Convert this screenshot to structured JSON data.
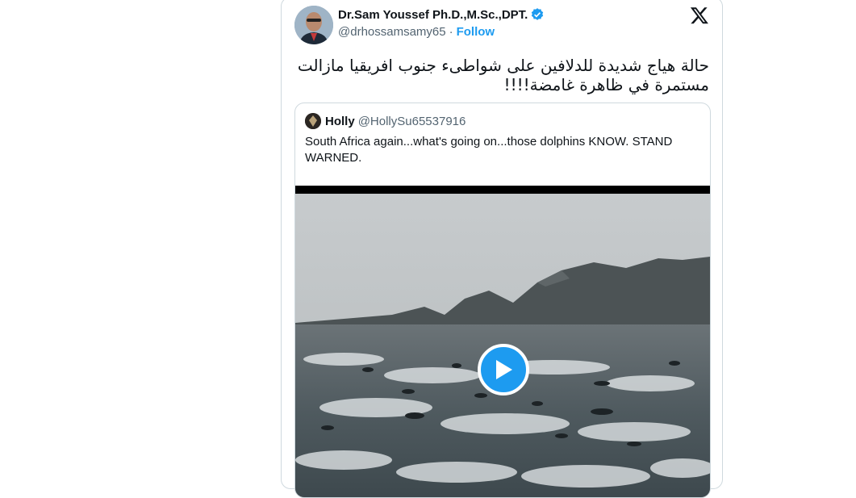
{
  "author": {
    "name": "Dr.Sam Youssef Ph.D.,M.Sc.,DPT.",
    "handle": "@drhossamsamy65",
    "separator": "·",
    "follow_label": "Follow",
    "verified_icon": "verified-badge-icon"
  },
  "brand": {
    "logo": "x-logo-icon"
  },
  "tweet": {
    "text_line1": "حالة هياج شديدة للدلافين على شواطىء جنوب افريقيا مازالت",
    "text_line2": "مستمرة في ظاهرة غامضة!!!!"
  },
  "quoted": {
    "name": "Holly",
    "handle": "@HollySu65537916",
    "text": "South Africa again...what's going on...those dolphins KNOW. STAND WARNED.",
    "media": {
      "type": "video",
      "play_icon": "play-icon"
    }
  },
  "colors": {
    "accent": "#1d9bf0",
    "text": "#0f1419",
    "muted": "#536471",
    "border": "#cfd9de"
  }
}
